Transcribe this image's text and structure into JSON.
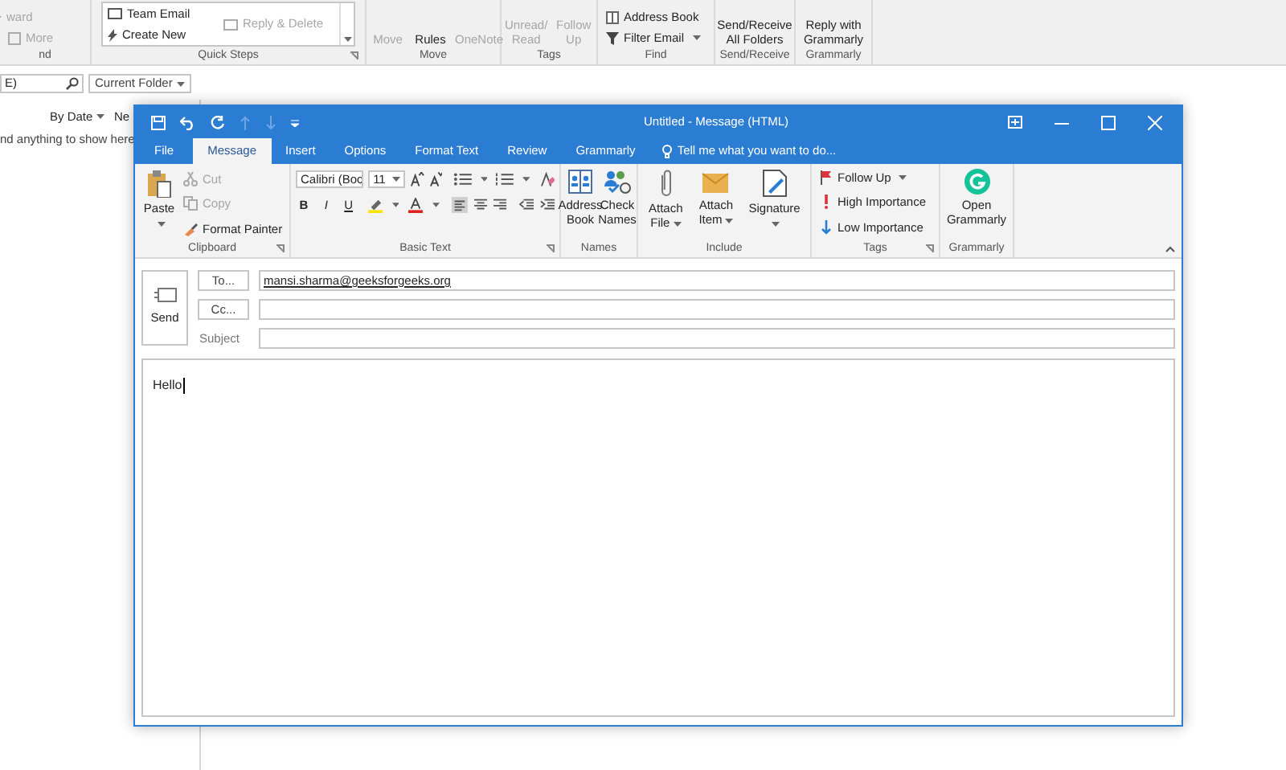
{
  "main_window": {
    "ribbon_groups": [
      {
        "label": "nd",
        "items": [
          {
            "text": "ward",
            "disabled": true
          },
          {
            "text": "More",
            "disabled": true
          }
        ]
      },
      {
        "label": "Quick Steps",
        "items": [
          {
            "text": "Team Email",
            "disabled": false
          },
          {
            "text": "Create New",
            "disabled": false
          },
          {
            "text": "Reply & Delete",
            "disabled": true
          }
        ]
      },
      {
        "label": "Move",
        "items": [
          {
            "text": "Move",
            "disabled": true
          },
          {
            "text": "Rules",
            "disabled": false
          },
          {
            "text": "OneNote",
            "disabled": true
          }
        ]
      },
      {
        "label": "Tags",
        "items": [
          {
            "text": "Unread/ Read",
            "disabled": true
          },
          {
            "text": "Follow Up",
            "disabled": true
          }
        ]
      },
      {
        "label": "Find",
        "items": [
          {
            "text": "Address Book",
            "disabled": false
          },
          {
            "text": "Filter Email",
            "disabled": false
          }
        ]
      },
      {
        "label": "Send/Receive",
        "items": [
          {
            "text": "Send/Receive All Folders",
            "disabled": false
          }
        ]
      },
      {
        "label": "Grammarly",
        "items": [
          {
            "text": "Reply with Grammarly",
            "disabled": false
          }
        ]
      }
    ],
    "search": {
      "value": "E)",
      "scope": "Current Folder"
    },
    "sort": {
      "by": "By Date",
      "order": "Ne"
    },
    "empty_message": "nd anything to show here"
  },
  "compose": {
    "title": "Untitled - Message (HTML)",
    "tabs": [
      {
        "label": "File",
        "selected": false
      },
      {
        "label": "Message",
        "selected": true
      },
      {
        "label": "Insert",
        "selected": false
      },
      {
        "label": "Options",
        "selected": false
      },
      {
        "label": "Format Text",
        "selected": false
      },
      {
        "label": "Review",
        "selected": false
      },
      {
        "label": "Grammarly",
        "selected": false
      }
    ],
    "tell_me": "Tell me what you want to do...",
    "clipboard": {
      "label": "Clipboard",
      "paste": "Paste",
      "items": [
        {
          "text": "Cut",
          "disabled": true
        },
        {
          "text": "Copy",
          "disabled": true
        },
        {
          "text": "Format Painter",
          "disabled": false
        }
      ]
    },
    "basic_text": {
      "label": "Basic Text",
      "font": "Calibri (Boc",
      "size": "11",
      "format_buttons": [
        "B",
        "I",
        "U"
      ]
    },
    "names": {
      "label": "Names",
      "items": [
        {
          "text": "Address Book"
        },
        {
          "text": "Check Names"
        }
      ]
    },
    "include": {
      "label": "Include",
      "items": [
        {
          "text": "Attach File",
          "dropdown": true
        },
        {
          "text": "Attach Item",
          "dropdown": true
        },
        {
          "text": "Signature",
          "dropdown": true
        }
      ]
    },
    "tags": {
      "label": "Tags",
      "items": [
        {
          "text": "Follow Up",
          "dropdown": true
        },
        {
          "text": "High Importance",
          "dropdown": false
        },
        {
          "text": "Low Importance",
          "dropdown": false
        }
      ]
    },
    "grammarly": {
      "label": "Grammarly",
      "button": "Open Grammarly"
    },
    "send": "Send",
    "to_button": "To...",
    "to_value": "mansi.sharma@geeksforgeeks.org",
    "cc_button": "Cc...",
    "subject_label": "Subject",
    "body": "Hello"
  }
}
